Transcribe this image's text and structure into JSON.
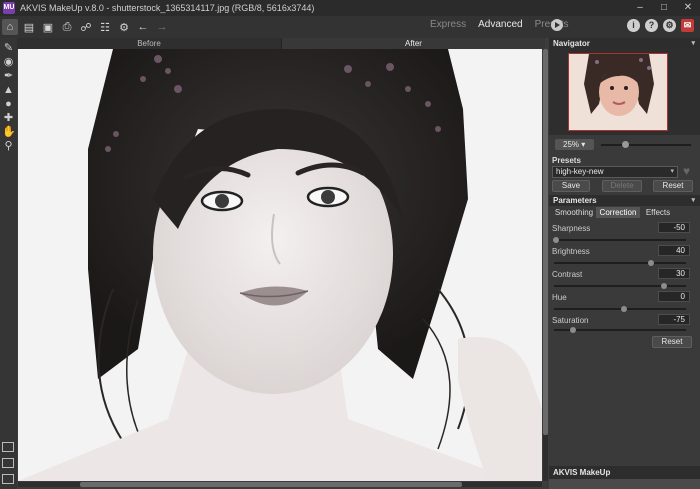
{
  "window": {
    "title": "AKVIS MakeUp v.8.0 - shutterstock_1365314117.jpg (RGB/8, 5616x3744)",
    "app_icon": "MU",
    "controls": [
      "minimize-icon",
      "maximize-icon",
      "close-icon"
    ]
  },
  "toolbar": {
    "buttons": [
      "home-icon",
      "open-icon",
      "save-icon",
      "print-icon",
      "share-icon",
      "batch-icon",
      "plugin-icon",
      "undo-icon",
      "redo-icon"
    ],
    "modes": [
      "Express",
      "Advanced",
      "Presets"
    ],
    "active_mode": "Advanced",
    "right_icons": [
      "info-icon",
      "help-icon",
      "settings-icon",
      "news-icon"
    ]
  },
  "view_tabs": {
    "before": "Before",
    "after": "After",
    "active": "After"
  },
  "tools": [
    "eraser-icon",
    "eye-icon",
    "brush-icon",
    "stamp-icon",
    "drop-icon",
    "heal-icon",
    "hand-icon",
    "zoom-icon"
  ],
  "navigator": {
    "title": "Navigator",
    "zoom": "25%"
  },
  "presets": {
    "label": "Presets",
    "selected": "high-key-new",
    "save": "Save",
    "delete": "Delete",
    "reset": "Reset"
  },
  "parameters": {
    "title": "Parameters",
    "tabs": [
      "Smoothing",
      "Correction",
      "Effects"
    ],
    "active_tab": "Correction",
    "items": [
      {
        "label": "Sharpness",
        "value": "-50"
      },
      {
        "label": "Brightness",
        "value": "40"
      },
      {
        "label": "Contrast",
        "value": "30"
      },
      {
        "label": "Hue",
        "value": "0"
      },
      {
        "label": "Saturation",
        "value": "-75"
      }
    ],
    "reset": "Reset"
  },
  "footer": {
    "title": "AKVIS MakeUp"
  },
  "colors": {
    "accent_red": "#c23a3a",
    "panel_bg": "#3a3a3a",
    "active_tab": "#555555"
  }
}
